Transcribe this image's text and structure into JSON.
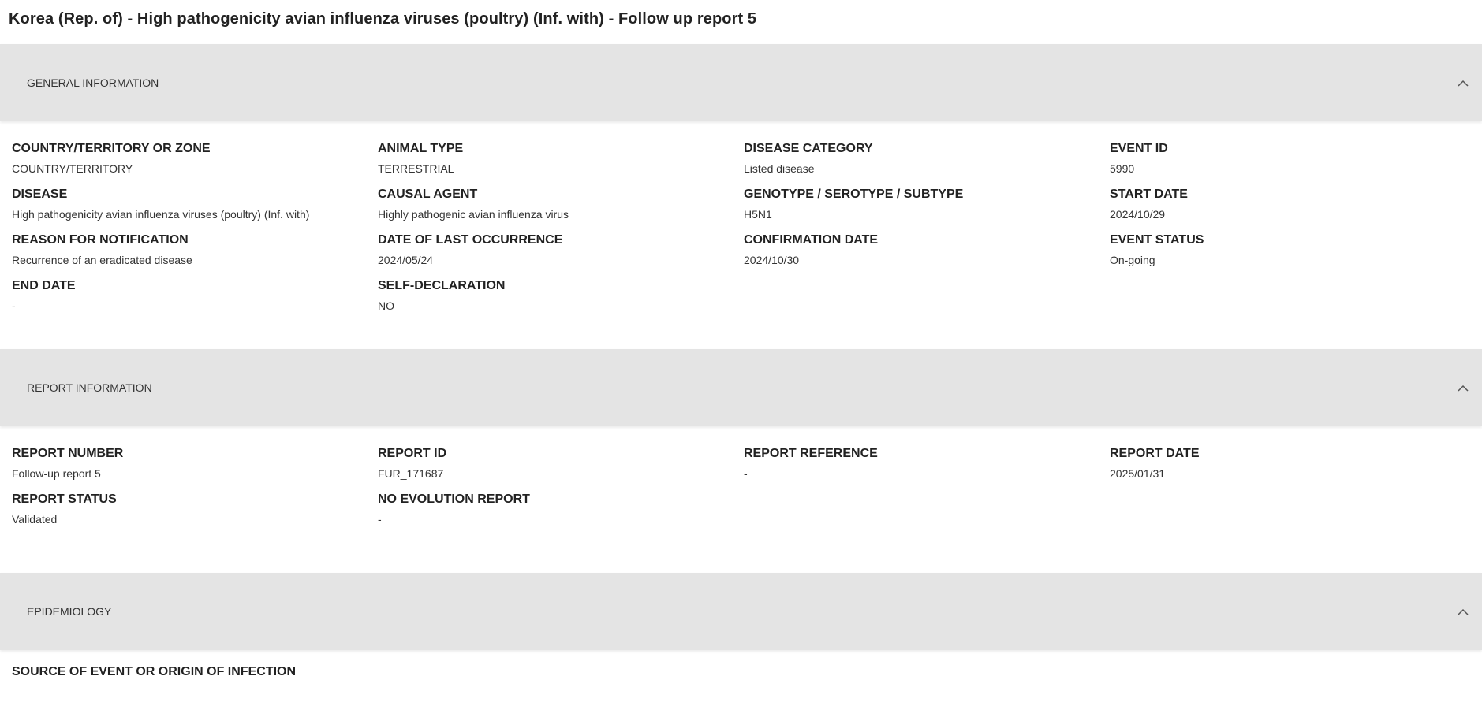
{
  "page": {
    "title": "Korea (Rep. of) - High pathogenicity avian influenza viruses (poultry) (Inf. with) - Follow up report 5"
  },
  "general_information": {
    "header": "GENERAL INFORMATION",
    "fields": [
      {
        "label": "COUNTRY/TERRITORY OR ZONE",
        "value": "COUNTRY/TERRITORY"
      },
      {
        "label": "ANIMAL TYPE",
        "value": "TERRESTRIAL"
      },
      {
        "label": "DISEASE CATEGORY",
        "value": "Listed disease"
      },
      {
        "label": "EVENT ID",
        "value": "5990"
      },
      {
        "label": "DISEASE",
        "value": "High pathogenicity avian influenza viruses (poultry) (Inf. with)"
      },
      {
        "label": "CAUSAL AGENT",
        "value": "Highly pathogenic avian influenza virus"
      },
      {
        "label": "GENOTYPE / SEROTYPE / SUBTYPE",
        "value": "H5N1"
      },
      {
        "label": "START DATE",
        "value": "2024/10/29"
      },
      {
        "label": "REASON FOR NOTIFICATION",
        "value": "Recurrence of an eradicated disease"
      },
      {
        "label": "DATE OF LAST OCCURRENCE",
        "value": "2024/05/24"
      },
      {
        "label": "CONFIRMATION DATE",
        "value": "2024/10/30"
      },
      {
        "label": "EVENT STATUS",
        "value": "On-going"
      },
      {
        "label": "END DATE",
        "value": "-"
      },
      {
        "label": "SELF-DECLARATION",
        "value": "NO"
      }
    ]
  },
  "report_information": {
    "header": "REPORT INFORMATION",
    "fields": [
      {
        "label": "REPORT NUMBER",
        "value": "Follow-up report 5"
      },
      {
        "label": "REPORT ID",
        "value": "FUR_171687"
      },
      {
        "label": "REPORT REFERENCE",
        "value": "-"
      },
      {
        "label": "REPORT DATE",
        "value": "2025/01/31"
      },
      {
        "label": "REPORT STATUS",
        "value": "Validated"
      },
      {
        "label": "NO EVOLUTION REPORT",
        "value": "-"
      }
    ]
  },
  "epidemiology": {
    "header": "EPIDEMIOLOGY",
    "fields": [
      {
        "label": "SOURCE OF EVENT OR ORIGIN OF INFECTION"
      }
    ]
  },
  "icons": {
    "collapse": "chevron-up-icon"
  },
  "colors": {
    "section_header_bg": "#e4e4e4",
    "text": "#222222"
  }
}
